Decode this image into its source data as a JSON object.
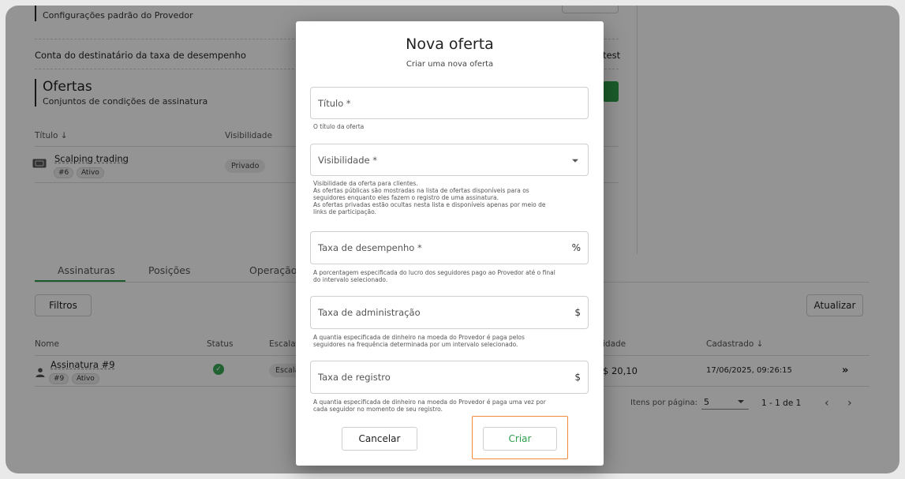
{
  "settings": {
    "provider_defaults_sub": "Configurações padrão do Provedor",
    "fee_account_label": "Conta do destinatário da taxa de desempenho",
    "fee_account_value": "test"
  },
  "offers": {
    "title": "Ofertas",
    "subtitle": "Conjuntos de condições de assinatura",
    "columns": {
      "title": "Título ↓",
      "visibility": "Visibilidade"
    },
    "rows": [
      {
        "name": "Scalping trading",
        "id": "#6",
        "status": "Ativo",
        "visibility": "Privado"
      }
    ]
  },
  "tabs": [
    "Assinaturas",
    "Posições",
    "Operação"
  ],
  "filters_label": "Filtros",
  "refresh_label": "Atualizar",
  "subs_table": {
    "columns": {
      "name": "Nome",
      "status": "Status",
      "scale": "Escala",
      "equity": "idade",
      "registered": "Cadastrado ↓"
    },
    "rows": [
      {
        "name": "Assinatura #9",
        "id": "#9",
        "status_text": "Ativo",
        "scale": "Escala",
        "equity": "$ 20,10",
        "registered": "17/06/2025, 09:26:15"
      }
    ]
  },
  "pagination": {
    "items_per_page_label": "Itens por página:",
    "items_per_page_value": "5",
    "range": "1 - 1 de 1"
  },
  "modal": {
    "title": "Nova oferta",
    "subtitle": "Criar uma nova oferta",
    "fields": {
      "title": {
        "label": "Título *",
        "helper": "O título da oferta"
      },
      "visibility": {
        "label": "Visibilidade *",
        "helper": [
          "Visibilidade da oferta para clientes.",
          "As ofertas públicas são mostradas na lista de ofertas disponíveis para os",
          "seguidores enquanto eles fazem o registro de uma assinatura.",
          "As ofertas privadas estão ocultas nesta lista e disponíveis apenas por meio de",
          "links de participação."
        ]
      },
      "performance_fee": {
        "label": "Taxa de desempenho *",
        "suffix": "%",
        "helper": [
          "A porcentagem especificada do lucro dos seguidores pago ao Provedor até o final",
          "do intervalo selecionado."
        ]
      },
      "management_fee": {
        "label": "Taxa de administração",
        "suffix": "$",
        "helper": [
          "A quantia especificada de dinheiro na moeda do Provedor é paga pelos",
          "seguidores na frequência determinada por um intervalo selecionado."
        ]
      },
      "registration_fee": {
        "label": "Taxa de registro",
        "suffix": "$",
        "helper": [
          "A quantia especificada de dinheiro na moeda do Provedor é paga uma vez por",
          "cada seguidor no momento de seu registro."
        ]
      }
    },
    "cancel_label": "Cancelar",
    "create_label": "Criar"
  },
  "colors": {
    "accent": "#2e9f4a",
    "highlight": "#f08a3a"
  }
}
